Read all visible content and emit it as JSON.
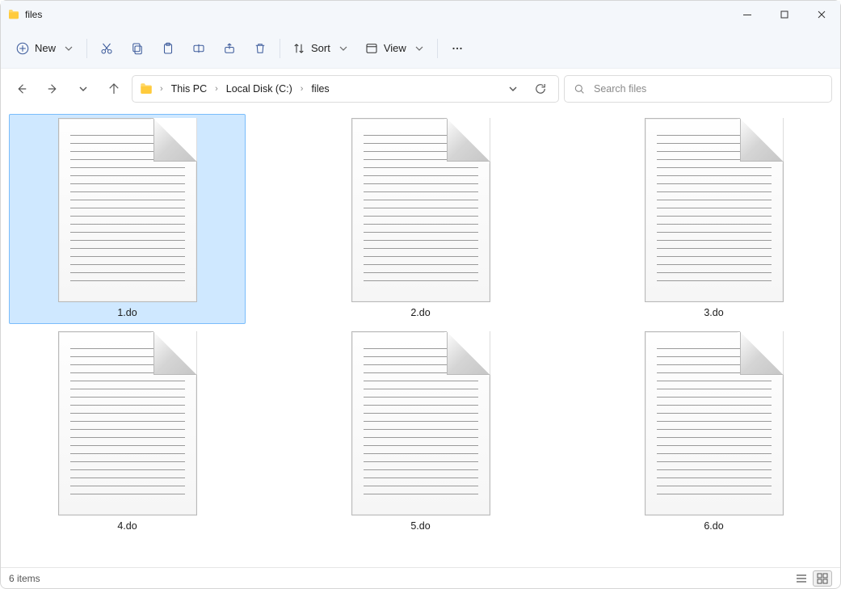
{
  "window": {
    "title": "files"
  },
  "toolbar": {
    "new_label": "New",
    "sort_label": "Sort",
    "view_label": "View"
  },
  "breadcrumb": {
    "segments": [
      "This PC",
      "Local Disk (C:)",
      "files"
    ]
  },
  "search": {
    "placeholder": "Search files"
  },
  "files": [
    {
      "name": "1.do",
      "selected": true
    },
    {
      "name": "2.do",
      "selected": false
    },
    {
      "name": "3.do",
      "selected": false
    },
    {
      "name": "4.do",
      "selected": false
    },
    {
      "name": "5.do",
      "selected": false
    },
    {
      "name": "6.do",
      "selected": false
    }
  ],
  "status": {
    "text": "6 items"
  }
}
